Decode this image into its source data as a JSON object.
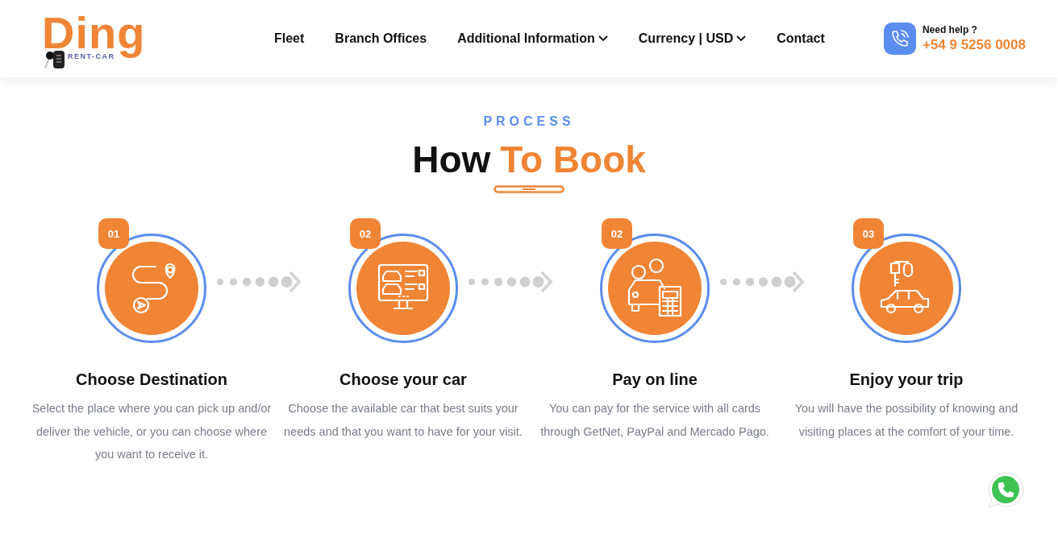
{
  "logo": {
    "name": "Ding",
    "tagline": "RENT-CAR"
  },
  "nav": [
    {
      "label": "Fleet",
      "has_menu": false
    },
    {
      "label": "Branch Offices",
      "has_menu": false
    },
    {
      "label": "Additional Information",
      "has_menu": true
    },
    {
      "label": "Currency | USD",
      "has_menu": true
    },
    {
      "label": "Contact",
      "has_menu": false
    }
  ],
  "help": {
    "label": "Need help ?",
    "phone": "+54 9 5256 0008"
  },
  "section": {
    "eyebrow": "PROCESS",
    "title_lead": "How",
    "title_accent": "To Book"
  },
  "steps": [
    {
      "badge": "01",
      "kind": "route",
      "title": "Choose Destination",
      "text": "Select the place where you can pick up and/or deliver the vehicle, or you can choose where you want to receive it."
    },
    {
      "badge": "02",
      "kind": "screen",
      "title": "Choose your car",
      "text": "Choose the available car that best suits your needs and that you want to have for your visit."
    },
    {
      "badge": "02",
      "kind": "payment",
      "title": "Pay on line",
      "text": "You can pay for the service with all cards through GetNet, PayPal and Mercado Pago."
    },
    {
      "badge": "03",
      "kind": "keys",
      "title": "Enjoy your trip",
      "text": "You will have the possibility of knowing and visiting places at the comfort of your time."
    }
  ]
}
